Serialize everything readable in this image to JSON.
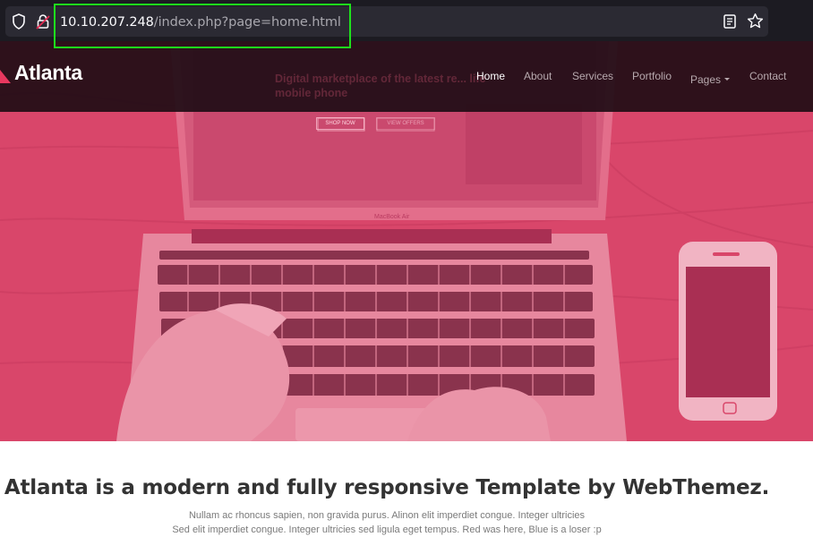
{
  "browser": {
    "url_host": "10.10.207.248",
    "url_path": "/index.php?page=home.html",
    "highlight_color": "#1ee31c",
    "icons": [
      "shield-icon",
      "lock-icon",
      "reader-view-icon",
      "bookmark-star-icon"
    ]
  },
  "site": {
    "brand": "Atlanta",
    "nav": [
      {
        "label": "Home",
        "active": true
      },
      {
        "label": "About",
        "active": false
      },
      {
        "label": "Services",
        "active": false
      },
      {
        "label": "Portfolio",
        "active": false
      },
      {
        "label": "Pages",
        "active": false,
        "dropdown": true
      },
      {
        "label": "Contact",
        "active": false
      }
    ],
    "hero": {
      "overlay_color": "#d9466a",
      "ghost_heading": "Digital marketplace of the latest re... life mobile phone",
      "ghost_buttons": [
        "SHOP NOW",
        "VIEW OFFERS"
      ],
      "laptop_label": "MacBook Air"
    },
    "intro": {
      "title": "Atlanta is a modern and fully responsive Template by WebThemez.",
      "line1": "Nullam ac rhoncus sapien, non gravida purus. Alinon elit imperdiet congue. Integer ultricies",
      "line2": "Sed elit imperdiet congue. Integer ultricies sed ligula eget tempus. Red was here, Blue is a loser :p"
    }
  }
}
